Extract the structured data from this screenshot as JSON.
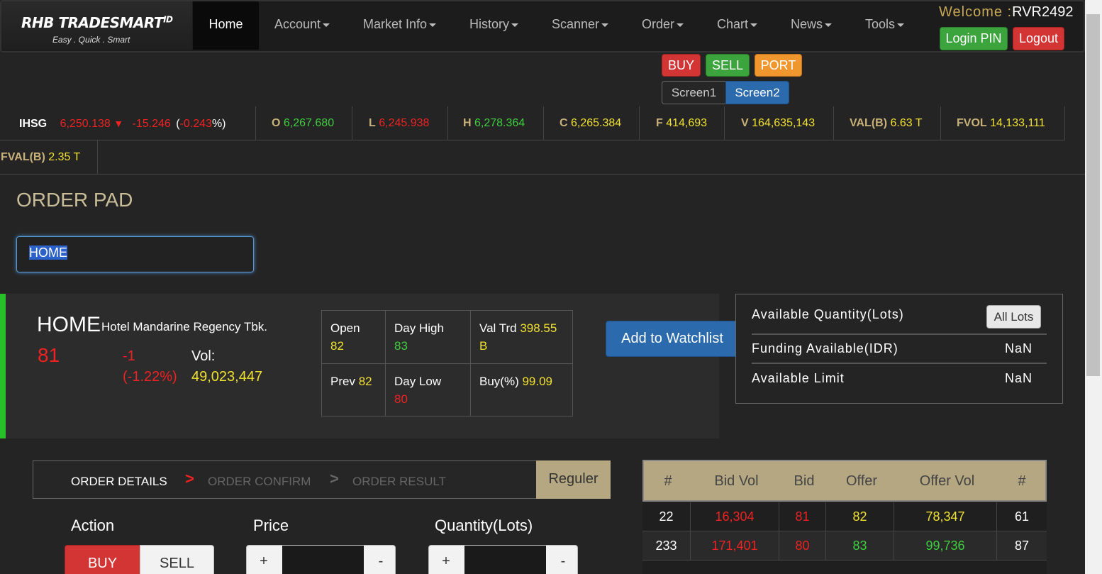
{
  "brand": {
    "name": "RHB TRADESMART",
    "suffix": "ID",
    "tagline": "Easy . Quick . Smart"
  },
  "nav": [
    {
      "label": "Home",
      "dropdown": false,
      "active": true
    },
    {
      "label": "Account",
      "dropdown": true
    },
    {
      "label": "Market Info",
      "dropdown": true
    },
    {
      "label": "History",
      "dropdown": true
    },
    {
      "label": "Scanner",
      "dropdown": true
    },
    {
      "label": "Order",
      "dropdown": true
    },
    {
      "label": "Chart",
      "dropdown": true
    },
    {
      "label": "News",
      "dropdown": true
    },
    {
      "label": "Tools",
      "dropdown": true
    }
  ],
  "user": {
    "welcome": "Welcome :",
    "username": "RVR2492",
    "login_pin": "Login PIN",
    "logout": "Logout"
  },
  "quick": {
    "buy": "BUY",
    "sell": "SELL",
    "port": "PORT",
    "screen1": "Screen1",
    "screen2": "Screen2"
  },
  "index": {
    "name": "IHSG",
    "value": "6,250.138",
    "change": "-15.246",
    "change_pct": "-0.243",
    "open_lbl": "O",
    "open": "6,267.680",
    "low_lbl": "L",
    "low": "6,245.938",
    "high_lbl": "H",
    "high": "6,278.364",
    "close_lbl": "C",
    "close": "6,265.384",
    "freq_lbl": "F",
    "freq": "414,693",
    "vol_lbl": "V",
    "vol": "164,635,143",
    "val_lbl": "VAL(B)",
    "val": "6.63 T",
    "fvol_lbl": "FVOL",
    "fvol": "14,133,111",
    "fval_lbl": "FVAL(B)",
    "fval": "2.35 T"
  },
  "page_title": "ORDER PAD",
  "symbol_input": "HOME",
  "stock": {
    "code": "HOME",
    "name": "Hotel Mandarine Regency Tbk.",
    "last": "81",
    "change": "-1",
    "change_pct": "(-1.22%)",
    "vol_label": "Vol:",
    "vol": "49,023,447",
    "open_lbl": "Open",
    "open": "82",
    "high_lbl": "Day High",
    "high": "83",
    "valtrd_lbl": "Val Trd",
    "valtrd": "398.55 B",
    "prev_lbl": "Prev",
    "prev": "82",
    "low_lbl": "Day Low",
    "low": "80",
    "buypct_lbl": "Buy(%)",
    "buypct": "99.09"
  },
  "watchlist_btn": "Add to Watchlist",
  "availability": {
    "qty_label": "Available Quantity(Lots)",
    "all_lots": "All Lots",
    "funding_label": "Funding Available(IDR)",
    "funding": "NaN",
    "limit_label": "Available Limit",
    "limit": "NaN"
  },
  "steps": {
    "s1": "ORDER DETAILS",
    "s2": "ORDER CONFIRM",
    "s3": "ORDER RESULT",
    "arrow": ">",
    "board": "Reguler"
  },
  "form": {
    "action_label": "Action",
    "price_label": "Price",
    "qty_label": "Quantity(Lots)",
    "buy": "BUY",
    "sell": "SELL",
    "plus": "+",
    "minus": "-"
  },
  "orderbook": {
    "headers": [
      "#",
      "Bid Vol",
      "Bid",
      "Offer",
      "Offer Vol",
      "#"
    ],
    "rows": [
      [
        "22",
        "16,304",
        "81",
        "82",
        "78,347",
        "61"
      ],
      [
        "233",
        "171,401",
        "80",
        "83",
        "99,736",
        "87"
      ]
    ]
  },
  "colors": {
    "up": "#3fce3f",
    "down": "#ee2222",
    "flat": "#f0e030",
    "accent": "#b5a782"
  }
}
